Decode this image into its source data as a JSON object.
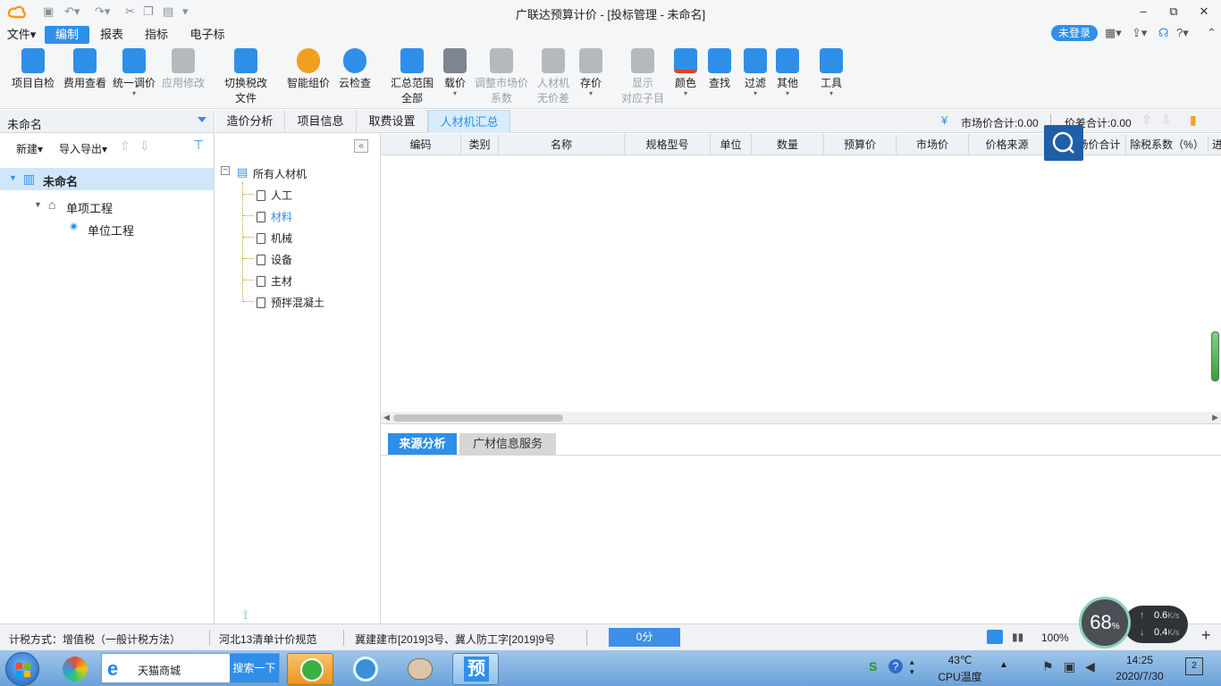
{
  "app": {
    "title": "广联达预算计价 - [投标管理 - 未命名]",
    "window_controls": {
      "minimize": "–",
      "restore": "⧉",
      "close": "✕"
    }
  },
  "menus": [
    "文件▾",
    "编制",
    "报表",
    "指标",
    "电子标"
  ],
  "active_menu": "编制",
  "login_label": "未登录",
  "ribbon": {
    "items": [
      {
        "label": "项目自检",
        "icon": "check-icon"
      },
      {
        "label": "费用查看",
        "icon": "cost-icon"
      },
      {
        "label": "统一调价",
        "icon": "adjust-icon"
      },
      {
        "label": "应用修改",
        "icon": "apply-icon"
      },
      {
        "label": "切换税改",
        "label2": "文件",
        "icon": "tax-icon"
      },
      {
        "label": "智能组价",
        "icon": "smart-icon"
      },
      {
        "label": "云检查",
        "icon": "cloud-check-icon"
      },
      {
        "label": "汇总范围",
        "label2": "全部",
        "icon": "summary-icon"
      },
      {
        "label": "载价",
        "icon": "load-price-icon"
      },
      {
        "label": "调整市场价",
        "label2": "系数",
        "icon": "market-coef-icon"
      },
      {
        "label": "人材机",
        "label2": "无价差",
        "icon": "balance-icon"
      },
      {
        "label": "存价",
        "icon": "save-price-icon"
      },
      {
        "label": "显示",
        "label2": "对应子目",
        "icon": "show-icon"
      },
      {
        "label": "颜色",
        "icon": "color-icon"
      },
      {
        "label": "查找",
        "icon": "find-icon"
      },
      {
        "label": "过滤",
        "icon": "filter-icon"
      },
      {
        "label": "其他",
        "icon": "other-icon"
      },
      {
        "label": "工具",
        "icon": "tool-icon"
      }
    ]
  },
  "left": {
    "project_name": "未命名",
    "toolbar": {
      "new": "新建▾",
      "import_export": "导入导出▾"
    },
    "tree": [
      {
        "label": "未命名",
        "level": 0
      },
      {
        "label": "单项工程",
        "level": 1
      },
      {
        "label": "单位工程",
        "level": 2
      }
    ]
  },
  "tabs": [
    "造价分析",
    "项目信息",
    "取费设置",
    "人材机汇总"
  ],
  "active_tab": "人材机汇总",
  "totals": {
    "market": "市场价合计:0.00",
    "diff": "价差合计:0.00"
  },
  "categories": {
    "root": "所有人材机",
    "items": [
      "人工",
      "材料",
      "机械",
      "设备",
      "主材",
      "预拌混凝土"
    ],
    "selected": "材料"
  },
  "grid": {
    "columns": [
      "编码",
      "类别",
      "名称",
      "规格型号",
      "单位",
      "数量",
      "预算价",
      "市场价",
      "价格来源",
      "市场价合计",
      "除税系数（%）",
      "进"
    ]
  },
  "bottom_tabs": [
    "来源分析",
    "广材信息服务"
  ],
  "status": {
    "tax_method": "计税方式：增值税（一般计税方法）",
    "spec": "河北13清单计价规范",
    "doc": "冀建建市[2019]3号、冀人防工字[2019]9号",
    "score": "0分",
    "zoom": "100%"
  },
  "net_widget": {
    "percent": "68",
    "unit": "%",
    "up": "0.6",
    "down": "0.4",
    "speed_unit": "K/s"
  },
  "taskbar": {
    "search_text": "天猫商城",
    "search_button": "搜索一下",
    "pinned_label": "预",
    "temp": "43℃",
    "temp_label": "CPU温度",
    "time": "14:25",
    "date": "2020/7/30",
    "notification_count": "2"
  },
  "colors": {
    "accent": "#2f8fe8",
    "selected_row": "#cfe6fb",
    "taskbar": "#6aa2d8"
  }
}
